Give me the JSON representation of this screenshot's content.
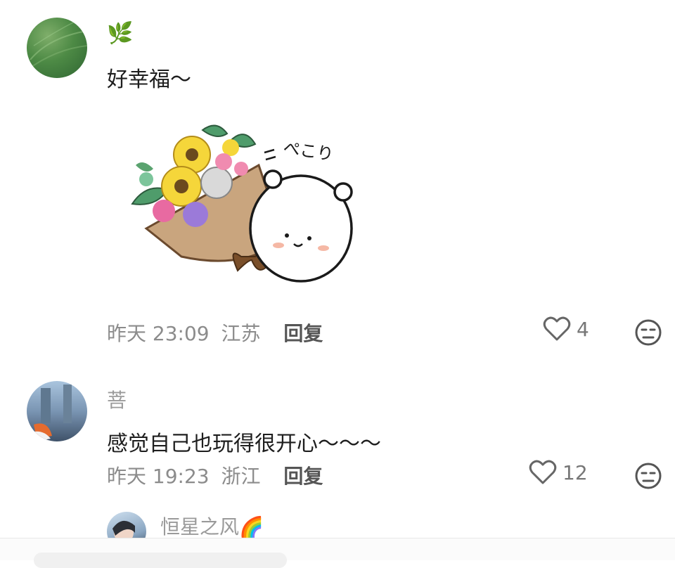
{
  "comments": [
    {
      "username": "🌿",
      "text": "好幸福～",
      "time": "昨天 23:09",
      "location": "江苏",
      "reply_label": "回复",
      "likes": "4",
      "sticker_caption": "ぺこり"
    },
    {
      "username": "菩",
      "text": "感觉自己也玩得很开心～～～",
      "time": "昨天 19:23",
      "location": "浙江",
      "reply_label": "回复",
      "likes": "12"
    },
    {
      "username": "恒星之风🌈"
    }
  ],
  "icons": {
    "like": "heart-outline-icon",
    "emoji": "neutral-face-icon"
  },
  "colors": {
    "meta_text": "#8c8c8c",
    "name_text": "#9a9a9a",
    "body_text": "#1e1e1e"
  }
}
